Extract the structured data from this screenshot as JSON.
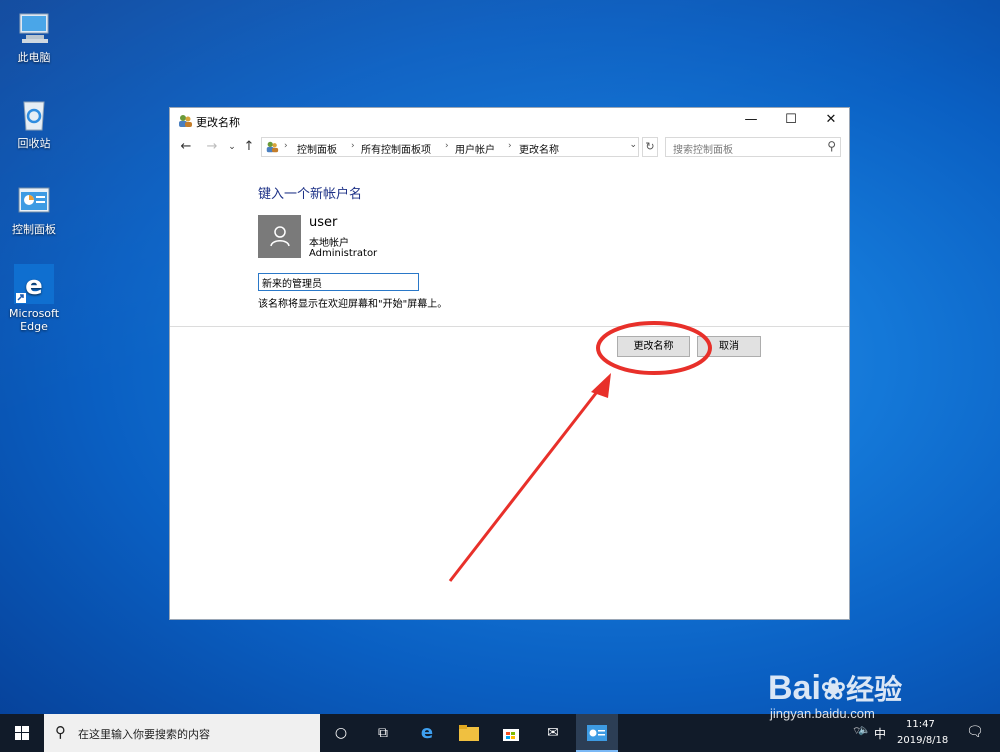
{
  "desktop": {
    "icons": [
      {
        "label": "此电脑"
      },
      {
        "label": "回收站"
      },
      {
        "label": "控制面板"
      },
      {
        "label": "Microsoft Edge"
      }
    ]
  },
  "window": {
    "title": "更改名称",
    "controls": {
      "minimize": "—",
      "maximize": "☐",
      "close": "✕"
    },
    "breadcrumbs": [
      "控制面板",
      "所有控制面板项",
      "用户帐户",
      "更改名称"
    ],
    "search_placeholder": "搜索控制面板",
    "heading": "键入一个新帐户名",
    "user": {
      "name": "user",
      "type": "本地帐户",
      "role": "Administrator"
    },
    "name_input_value": "新来的管理员",
    "hint": "该名称将显示在欢迎屏幕和\"开始\"屏幕上。",
    "buttons": {
      "confirm": "更改名称",
      "cancel": "取消"
    }
  },
  "taskbar": {
    "search_placeholder": "在这里输入你要搜索的内容",
    "ime": "中",
    "time": "11:47",
    "date": "2019/8/18"
  },
  "watermark": {
    "brand": "Bai",
    "brand_suffix": "经验",
    "url": "jingyan.baidu.com"
  },
  "colors": {
    "heading": "#1e3287",
    "annotation": "#e8302a",
    "taskbar": "#111b29"
  }
}
